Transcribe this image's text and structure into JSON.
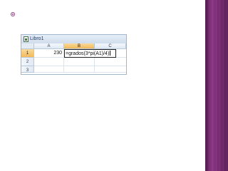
{
  "window": {
    "title": "Libro1"
  },
  "sheet": {
    "columns": [
      "A",
      "B",
      "C"
    ],
    "rows": [
      "1",
      "2",
      "3"
    ],
    "active_column": "B",
    "active_row": "1",
    "cells": {
      "A1": "230",
      "B1": "=grados(3*pi(A1)/4)"
    }
  },
  "colors": {
    "band": "#6d2566",
    "bullet": "#8e3a86",
    "header_active": "#f2b95b",
    "grid_border": "#9eb6ce"
  }
}
